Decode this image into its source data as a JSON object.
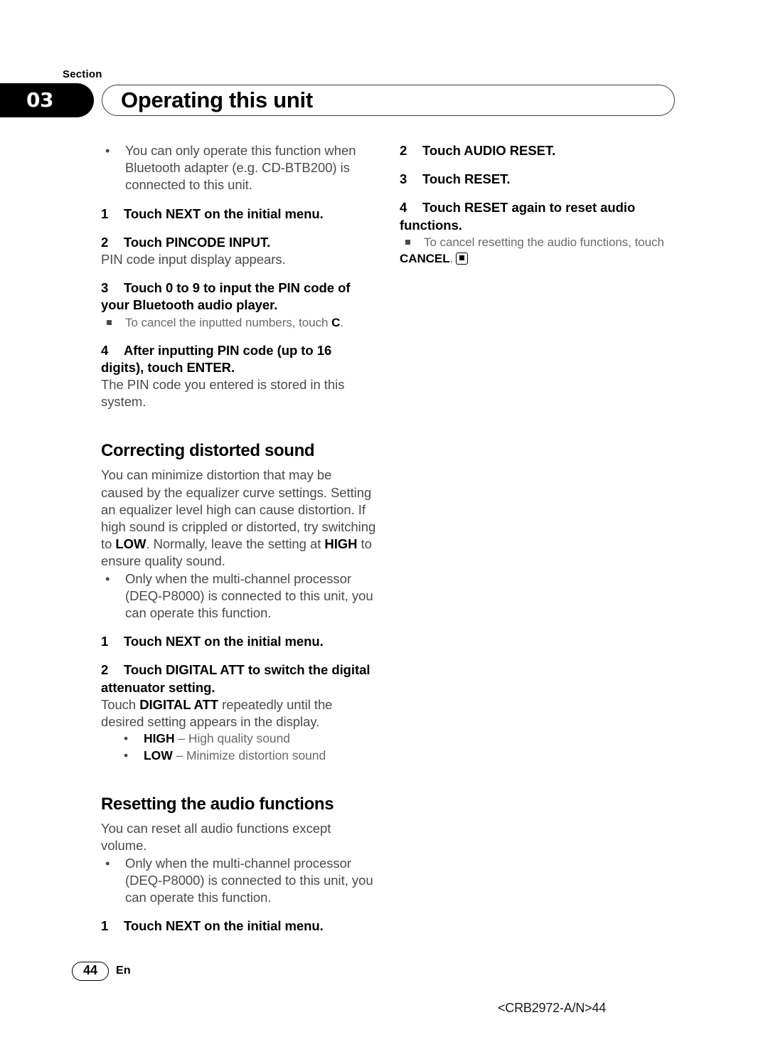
{
  "header": {
    "section_label": "Section",
    "section_number": "03",
    "title": "Operating this unit"
  },
  "left_column": {
    "blocks": [
      {
        "type": "bullet",
        "text": "You can only operate this function when Bluetooth adapter (e.g. CD-BTB200) is connected to this unit."
      },
      {
        "type": "step",
        "num": "1",
        "text": "Touch NEXT on the initial menu."
      },
      {
        "type": "step",
        "num": "2",
        "text": "Touch PINCODE INPUT."
      },
      {
        "type": "para",
        "text": "PIN code input display appears."
      },
      {
        "type": "step",
        "num": "3",
        "text": "Touch 0 to 9 to input the PIN code of your Bluetooth audio player."
      },
      {
        "type": "square-note",
        "text_before": "To cancel the inputted numbers, touch ",
        "bold": "C",
        "text_after": "."
      },
      {
        "type": "step",
        "num": "4",
        "text": "After inputting PIN code (up to 16 digits), touch ENTER."
      },
      {
        "type": "para",
        "text": "The PIN code you entered is stored in this system."
      }
    ],
    "heading_distorted": "Correcting distorted sound",
    "distorted_intro_1": "You can minimize distortion that may be caused by the equalizer curve settings. Setting an equalizer level high can cause distortion. If high sound is crippled or distorted, try switching to ",
    "distorted_low": "LOW",
    "distorted_intro_2": ". Normally, leave the setting at ",
    "distorted_high": "HIGH",
    "distorted_intro_3": " to ensure quality sound.",
    "distorted_bullet": "Only when the multi-channel processor (DEQ-P8000) is connected to this unit, you can operate this function.",
    "distorted_step1_num": "1",
    "distorted_step1": "Touch NEXT on the initial menu.",
    "distorted_step2_num": "2",
    "distorted_step2": "Touch DIGITAL ATT to switch the digital attenuator setting.",
    "distorted_step2_body_1": "Touch ",
    "distorted_step2_body_bold": "DIGITAL ATT",
    "distorted_step2_body_2": " repeatedly until the desired setting appears in the display.",
    "option_high_label": "HIGH",
    "option_high_desc": " – High quality sound",
    "option_low_label": "LOW",
    "option_low_desc": " – Minimize distortion sound",
    "heading_reset": "Resetting the audio functions",
    "reset_intro": "You can reset all audio functions except volume.",
    "reset_bullet": "Only when the multi-channel processor (DEQ-P8000) is connected to this unit, you can operate this function.",
    "reset_step1_num": "1",
    "reset_step1": "Touch NEXT on the initial menu."
  },
  "right_column": {
    "step2_num": "2",
    "step2": "Touch AUDIO RESET.",
    "step3_num": "3",
    "step3": "Touch RESET.",
    "step4_num": "4",
    "step4": "Touch RESET again to reset audio functions.",
    "cancel_note_before": "To cancel resetting the audio functions, touch ",
    "cancel_bold": "CANCEL",
    "cancel_after": ".",
    "end_mark": "end-of-section-marker"
  },
  "footer": {
    "page_number": "44",
    "language": "En",
    "document_code": "<CRB2972-A/N>44"
  }
}
